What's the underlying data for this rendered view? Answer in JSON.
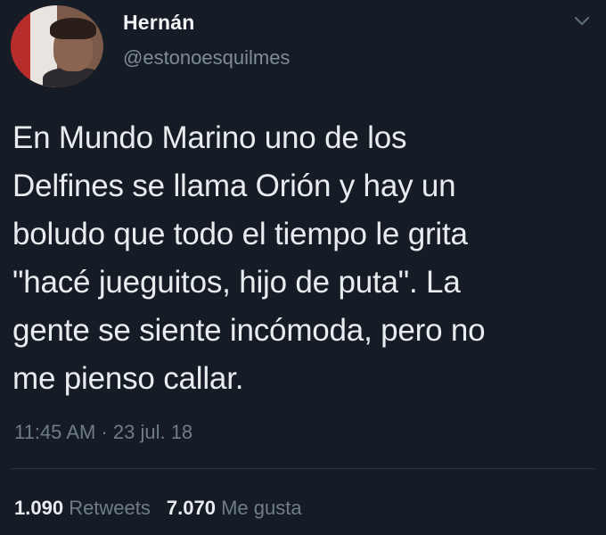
{
  "tweet": {
    "display_name": "Hernán",
    "username": "@estonoesquilmes",
    "text": "En Mundo Marino uno de los\nDelfines se llama Orión y hay un\nboludo que todo el tiempo le grita\n\"hacé jueguitos, hijo de puta\". La\ngente se siente incómoda, pero no\nme pienso callar.",
    "timestamp": "11:45 AM · 23 jul. 18",
    "retweets_count": "1.090",
    "retweets_label": "Retweets",
    "likes_count": "7.070",
    "likes_label": "Me gusta"
  },
  "icons": {
    "menu": "chevron-down-icon"
  },
  "colors": {
    "background": "#151c25",
    "primary_text": "#e9ecef",
    "secondary_text": "#6f7d8a"
  }
}
